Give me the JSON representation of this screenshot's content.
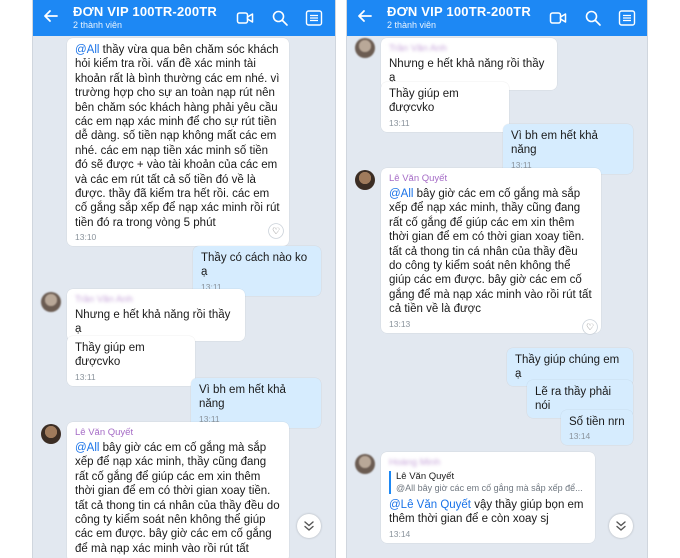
{
  "left_phone": {
    "header": {
      "title": "ĐƠN VIP 100TR-200TR",
      "subtitle": "2 thành viên"
    },
    "msg1": {
      "mention": "@All",
      "text": " thầy vừa qua bên chăm sóc khách hỏi kiểm tra rồi. vấn đề xác minh tài khoản rất là bình thường các em nhé. vì trường hợp cho sự an toàn nạp rút nên bên chăm sóc khách hàng phải yêu cầu các em nạp xác minh để cho sự rút tiền dễ dàng. số tiền nạp không mất các em nhé. các em nạp tiền xác minh số tiền đó sẽ được + vào tài khoản của các em và các em rút tất cả số tiền đó về là được. thầy đã kiểm tra hết rồi. các em cố gắng sắp xếp để nạp xác minh rồi rút tiền đó ra trong vòng 5 phút",
      "time": "13:10"
    },
    "msg2": {
      "text": "Thầy có cách nào ko ạ",
      "time": "13:11"
    },
    "msg3": {
      "sender": "Trần Văn Anh",
      "text": "Nhưng e hết khả năng rồi thầy ạ"
    },
    "msg4": {
      "text": "Thầy giúp em đượcvko",
      "time": "13:11"
    },
    "msg5": {
      "text": "Vì bh em hết khả năng",
      "time": "13:11"
    },
    "msg6": {
      "sender": "Lê Văn Quyết",
      "mention": "@All",
      "text": " bây giờ các em cố gắng mà sắp xếp để nạp xác minh, thầy cũng đang rất cố gắng để giúp các em xin thêm thời gian để em có thời gian xoay tiền. tất cả thong tin cá nhân của thầy đều do công ty kiểm soát nên  không thể giúp các em được. bây giờ các em cố gắng để mà nạp xác minh vào rồi rút tất"
    }
  },
  "right_phone": {
    "header": {
      "title": "ĐƠN VIP 100TR-200TR",
      "subtitle": "2 thành viên"
    },
    "msg1": {
      "sender": "Trần Văn Anh",
      "text": "Nhưng e hết khả năng rồi thầy ạ"
    },
    "msg2": {
      "text": "Thầy giúp em đượcvko",
      "time": "13:11"
    },
    "msg3": {
      "text": "Vì bh em hết khả năng",
      "time": "13:11"
    },
    "msg4": {
      "sender": "Lê Văn Quyết",
      "mention": "@All",
      "text": " bây giờ các em cố gắng mà sắp xếp để nạp xác minh, thầy cũng đang rất cố gắng để giúp các em xin thêm thời gian để em có thời gian xoay tiền. tất cả thong tin cá nhân của thầy đều do công ty kiểm soát nên  không thể giúp các em được. bây giờ các em cố gắng để mà nạp xác minh vào rồi rút tất cả tiền về là được",
      "time": "13:13"
    },
    "msg5": {
      "text": "Thầy giúp chúng em ạ"
    },
    "msg6": {
      "text": "Lẽ ra thầy phải nói"
    },
    "msg7": {
      "text": "Số tiền nrn",
      "time": "13:14"
    },
    "msg8": {
      "sender": "Hoàng Minh",
      "quote_name": "Lê Văn Quyết",
      "quote_text": "@All  bây giờ các em cố gắng mà sắp xếp để...",
      "mention": "@Lê Văn Quyết",
      "text": " vậy thầy giúp bọn em thêm thời gian để e còn xoay sj",
      "time": "13:14"
    }
  },
  "icons": {
    "back": "arrow-left-icon",
    "video": "video-call-icon",
    "search": "search-icon",
    "menu": "list-menu-icon",
    "heart": "heart-icon",
    "scroll": "chevron-double-down-icon"
  },
  "colors": {
    "header": "#1d88f4",
    "chat_bg": "#e2e8f0",
    "outgoing_bubble": "#d6ecfe",
    "incoming_bubble": "#ffffff",
    "mention": "#1a73e8",
    "sender_name": "#a56bc6"
  }
}
